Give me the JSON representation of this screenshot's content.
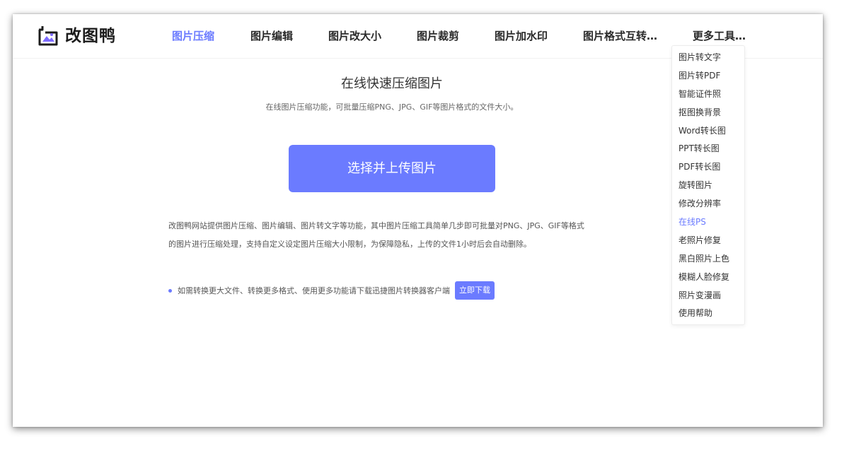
{
  "brand": {
    "name": "改图鸭",
    "icon": "image-frame-icon",
    "accent_color": "#6b7bff"
  },
  "nav": [
    {
      "label": "图片压缩",
      "active": true
    },
    {
      "label": "图片编辑"
    },
    {
      "label": "图片改大小"
    },
    {
      "label": "图片裁剪"
    },
    {
      "label": "图片加水印"
    },
    {
      "label": "图片格式互转…"
    },
    {
      "label": "更多工具…"
    }
  ],
  "more_menu": [
    {
      "label": "图片转文字"
    },
    {
      "label": "图片转PDF"
    },
    {
      "label": "智能证件照"
    },
    {
      "label": "抠图换背景"
    },
    {
      "label": "Word转长图"
    },
    {
      "label": "PPT转长图"
    },
    {
      "label": "PDF转长图"
    },
    {
      "label": "旋转图片"
    },
    {
      "label": "修改分辨率"
    },
    {
      "label": "在线PS",
      "active": true
    },
    {
      "label": "老照片修复"
    },
    {
      "label": "黑白照片上色"
    },
    {
      "label": "模糊人脸修复"
    },
    {
      "label": "照片变漫画"
    },
    {
      "label": "使用帮助"
    }
  ],
  "main": {
    "title": "在线快速压缩图片",
    "subtitle": "在线图片压缩功能，可批量压缩PNG、JPG、GIF等图片格式的文件大小。",
    "upload_label": "选择并上传图片",
    "description_line1": "改图鸭网站提供图片压缩、图片编辑、图片转文字等功能，其中图片压缩工具简单几步即可批量对PNG、JPG、GIF等格式",
    "description_line2": "的图片进行压缩处理，支持自定义设定图片压缩大小限制，为保障隐私，上传的文件1小时后会自动删除。",
    "notice": "如需转换更大文件、转换更多格式、使用更多功能请下载迅捷图片转换器客户端",
    "download_label": "立即下载"
  }
}
